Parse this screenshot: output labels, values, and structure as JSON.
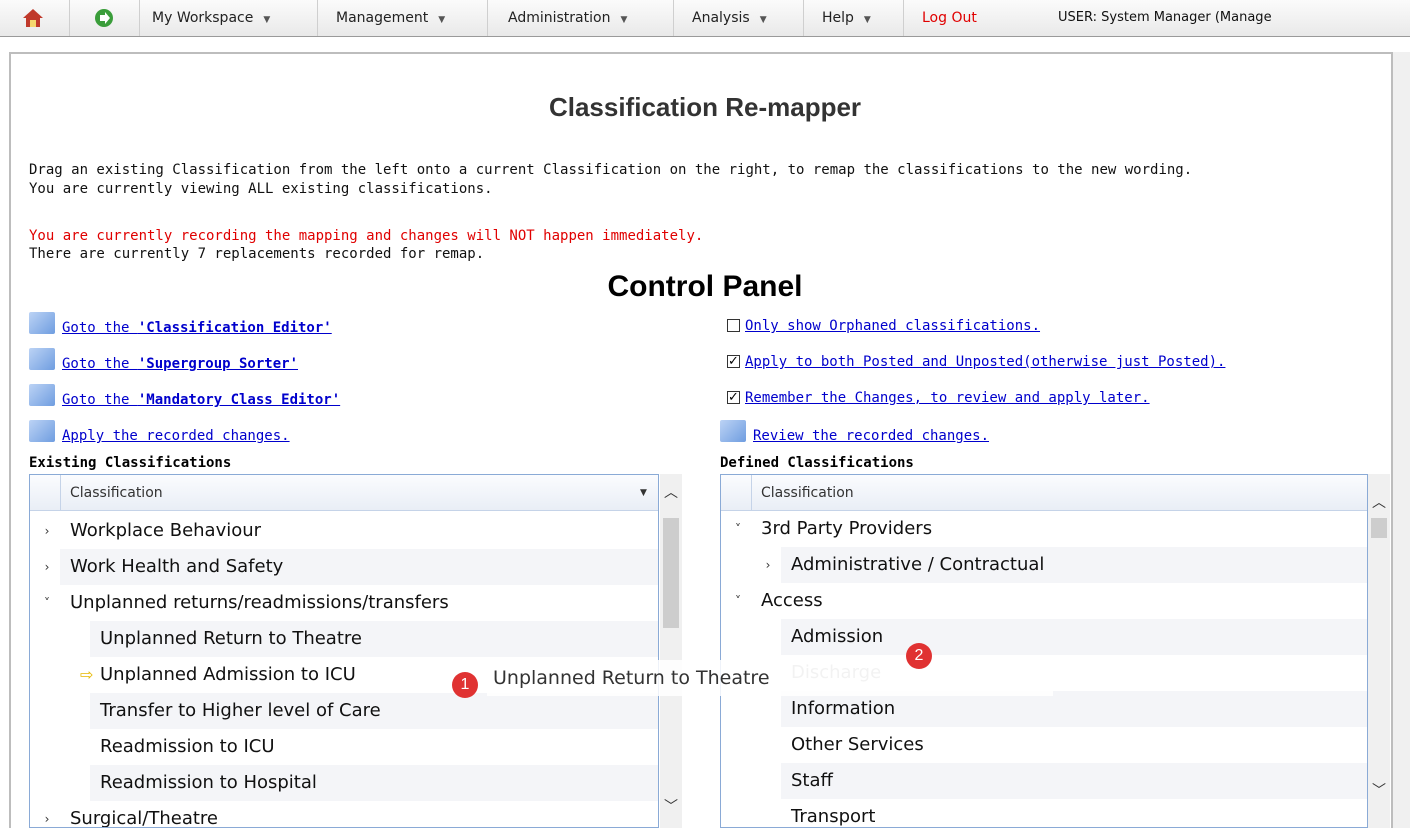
{
  "topbar": {
    "menus": [
      "My Workspace",
      "Management",
      "Administration",
      "Analysis",
      "Help"
    ],
    "logout": "Log Out",
    "user": "USER: System Manager (Manage"
  },
  "page": {
    "title": "Classification Re-mapper",
    "intro_line1": "Drag an existing Classification from the left onto a current Classification on the right, to remap the classifications to the new wording.",
    "intro_line2": "You are currently viewing ALL existing classifications.",
    "warning": "You are currently recording the mapping and changes will NOT happen immediately.",
    "replacements": "There are currently 7 replacements recorded for remap."
  },
  "control_panel": {
    "title": "Control Panel",
    "left_links": [
      {
        "prefix": "Goto the ",
        "bold": "'Classification Editor'"
      },
      {
        "prefix": "Goto the ",
        "bold": "'Supergroup Sorter'"
      },
      {
        "prefix": "Goto the ",
        "bold": "'Mandatory Class Editor'"
      },
      {
        "prefix": "Apply the recorded changes.",
        "bold": ""
      }
    ],
    "options": [
      {
        "label": "Only show Orphaned classifications.",
        "checked": false
      },
      {
        "label": "Apply to both Posted and Unposted(otherwise just Posted).",
        "checked": true
      },
      {
        "label": "Remember the Changes, to review and apply later.",
        "checked": true
      }
    ],
    "review_link": "Review the recorded changes."
  },
  "existing": {
    "heading": "Existing Classifications",
    "column": "Classification",
    "rows": [
      {
        "label": "Workplace Behaviour",
        "level": 0,
        "expander": "›"
      },
      {
        "label": "Work Health and Safety",
        "level": 0,
        "expander": "›"
      },
      {
        "label": "Unplanned returns/readmissions/transfers",
        "level": 0,
        "expander": "˅"
      },
      {
        "label": "Unplanned Return to Theatre",
        "level": 1,
        "expander": ""
      },
      {
        "label": "Unplanned Admission to ICU",
        "level": 1,
        "expander": ""
      },
      {
        "label": "Transfer to Higher level of Care",
        "level": 1,
        "expander": ""
      },
      {
        "label": "Readmission to ICU",
        "level": 1,
        "expander": ""
      },
      {
        "label": "Readmission to Hospital",
        "level": 1,
        "expander": ""
      },
      {
        "label": "Surgical/Theatre",
        "level": 0,
        "expander": "›"
      }
    ]
  },
  "defined": {
    "heading": "Defined Classifications",
    "column": "Classification",
    "rows": [
      {
        "label": "3rd Party Providers",
        "level": 0,
        "expander": "˅"
      },
      {
        "label": "Administrative / Contractual",
        "level": 1,
        "expander": "›"
      },
      {
        "label": "Access",
        "level": 0,
        "expander": "˅"
      },
      {
        "label": "Admission",
        "level": 1,
        "expander": ""
      },
      {
        "label": "Discharge",
        "level": 1,
        "expander": ""
      },
      {
        "label": "Information",
        "level": 1,
        "expander": ""
      },
      {
        "label": "Other Services",
        "level": 1,
        "expander": ""
      },
      {
        "label": "Staff",
        "level": 1,
        "expander": ""
      },
      {
        "label": "Transport",
        "level": 1,
        "expander": ""
      }
    ]
  },
  "drag": {
    "label": "Unplanned Return to Theatre",
    "badge1": "1",
    "badge2": "2"
  },
  "colors": {
    "accent": "#0000cc",
    "warning": "#e00000",
    "grid_border": "#8aaad6"
  }
}
